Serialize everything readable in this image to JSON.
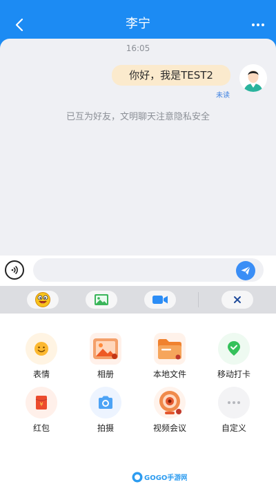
{
  "header": {
    "title": "李宁",
    "back_icon": "chevron-left-icon",
    "more_icon": "more-dots-icon",
    "bg_color": "#1c8bf3"
  },
  "chat": {
    "time": "16:05",
    "message": "你好，我是TEST2",
    "status": "未读",
    "system_notice": "已互为好友，文明聊天注意隐私安全",
    "bubble_color": "#fbeacd"
  },
  "input": {
    "placeholder": "",
    "voice_icon": "voice-icon",
    "send_icon": "send-icon"
  },
  "toolbar": {
    "items": [
      "emoji-face-icon",
      "image-icon",
      "video-call-icon",
      "close-icon"
    ]
  },
  "functions": [
    {
      "label": "表情",
      "icon": "emoji-icon"
    },
    {
      "label": "相册",
      "icon": "album-icon"
    },
    {
      "label": "本地文件",
      "icon": "folder-icon"
    },
    {
      "label": "移动打卡",
      "icon": "location-checkin-icon"
    },
    {
      "label": "红包",
      "icon": "red-packet-icon"
    },
    {
      "label": "拍摄",
      "icon": "camera-icon"
    },
    {
      "label": "视频会议",
      "icon": "video-meeting-icon"
    },
    {
      "label": "自定义",
      "icon": "custom-more-icon"
    }
  ],
  "watermark": {
    "text": "GOGO手游网"
  }
}
